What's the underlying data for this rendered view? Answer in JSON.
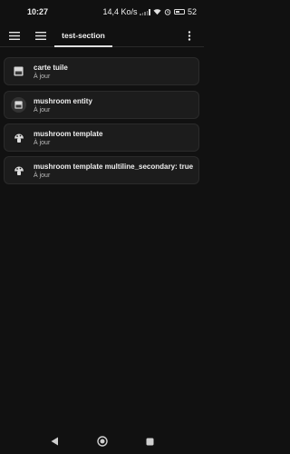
{
  "status_bar": {
    "time": "10:27",
    "net_speed": "14,4 Ko/s",
    "battery": "52",
    "battery_level": 0.52
  },
  "app_bar": {
    "menu_icon": "hamburger-icon",
    "sections_icon": "list-icon",
    "tab_label": "test-section",
    "overflow_icon": "more-vertical-icon"
  },
  "cards": [
    {
      "title": "carte tuile",
      "subtitle": "À jour",
      "icon": "tile-icon"
    },
    {
      "title": "mushroom entity",
      "subtitle": "À jour",
      "icon": "tile-icon"
    },
    {
      "title": "mushroom template",
      "subtitle": "À jour",
      "icon": "mushroom-icon"
    },
    {
      "title": "mushroom template multiline_secondary: true",
      "subtitle": "À jour",
      "icon": "mushroom-icon"
    }
  ],
  "nav_bar": {
    "back_icon": "back-triangle-icon",
    "home_icon": "home-circle-icon",
    "recents_icon": "recents-square-icon"
  },
  "colors": {
    "background": "#111111",
    "card": "#1c1c1c",
    "text": "#efefef"
  }
}
